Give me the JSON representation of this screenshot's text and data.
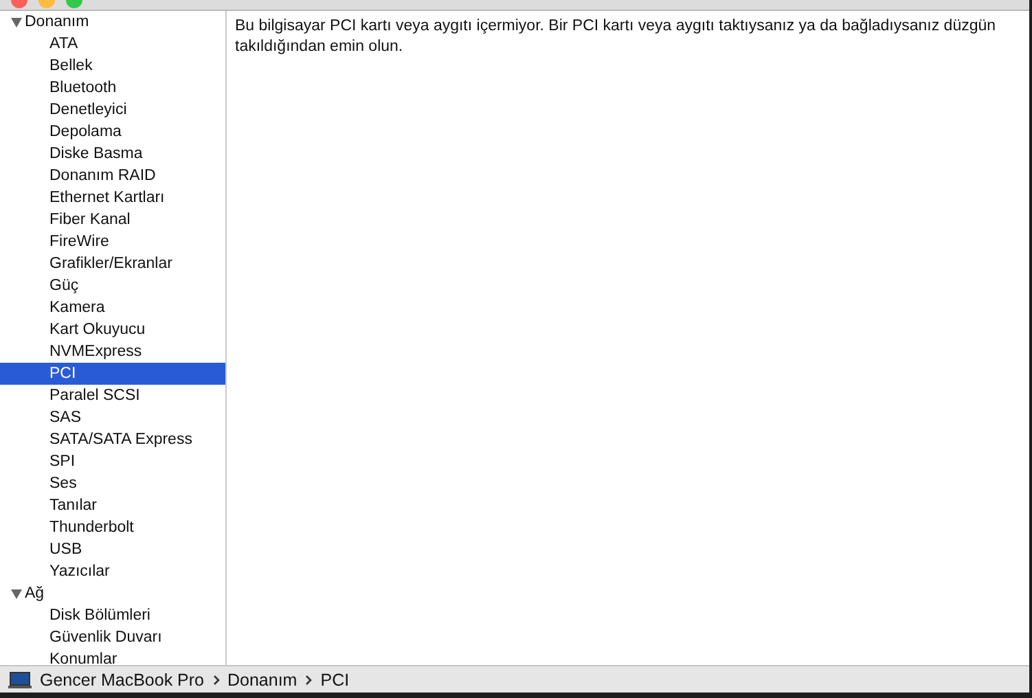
{
  "sidebar": {
    "groups": [
      {
        "label": "Donanım",
        "expanded": true,
        "children": [
          {
            "label": "ATA",
            "selected": false
          },
          {
            "label": "Bellek",
            "selected": false
          },
          {
            "label": "Bluetooth",
            "selected": false
          },
          {
            "label": "Denetleyici",
            "selected": false
          },
          {
            "label": "Depolama",
            "selected": false
          },
          {
            "label": "Diske Basma",
            "selected": false
          },
          {
            "label": "Donanım RAID",
            "selected": false
          },
          {
            "label": "Ethernet Kartları",
            "selected": false
          },
          {
            "label": "Fiber Kanal",
            "selected": false
          },
          {
            "label": "FireWire",
            "selected": false
          },
          {
            "label": "Grafikler/Ekranlar",
            "selected": false
          },
          {
            "label": "Güç",
            "selected": false
          },
          {
            "label": "Kamera",
            "selected": false
          },
          {
            "label": "Kart Okuyucu",
            "selected": false
          },
          {
            "label": "NVMExpress",
            "selected": false
          },
          {
            "label": "PCI",
            "selected": true
          },
          {
            "label": "Paralel SCSI",
            "selected": false
          },
          {
            "label": "SAS",
            "selected": false
          },
          {
            "label": "SATA/SATA Express",
            "selected": false
          },
          {
            "label": "SPI",
            "selected": false
          },
          {
            "label": "Ses",
            "selected": false
          },
          {
            "label": "Tanılar",
            "selected": false
          },
          {
            "label": "Thunderbolt",
            "selected": false
          },
          {
            "label": "USB",
            "selected": false
          },
          {
            "label": "Yazıcılar",
            "selected": false
          }
        ]
      },
      {
        "label": "Ağ",
        "expanded": true,
        "children": [
          {
            "label": "Disk Bölümleri",
            "selected": false
          },
          {
            "label": "Güvenlik Duvarı",
            "selected": false
          },
          {
            "label": "Konumlar",
            "selected": false
          }
        ]
      }
    ]
  },
  "content": {
    "message": "Bu bilgisayar PCI kartı veya aygıtı içermiyor. Bir PCI kartı veya aygıtı taktıysanız ya da bağladıysanız düzgün takıldığından emin olun."
  },
  "path_bar": {
    "segments": [
      "Gencer MacBook Pro",
      "Donanım",
      "PCI"
    ]
  }
}
